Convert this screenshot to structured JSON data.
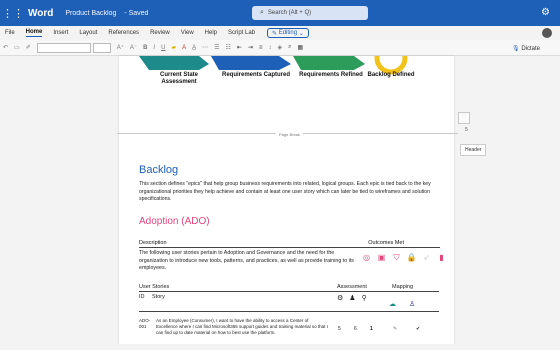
{
  "titlebar": {
    "app_name": "Word",
    "doc_title": "Product Backlog",
    "save_state": "- Saved",
    "search_placeholder": "Search (Alt + Q)"
  },
  "menu": {
    "tabs": [
      "File",
      "Home",
      "Insert",
      "Layout",
      "References",
      "Review",
      "View",
      "Help",
      "Script Lab"
    ],
    "active": "Home",
    "editing_label": "Editing"
  },
  "ribbon": {
    "dictate_label": "Dictate"
  },
  "document": {
    "stages": [
      {
        "label": "Current State Assessment"
      },
      {
        "label": "Requirements Captured"
      },
      {
        "label": "Requirements Refined"
      },
      {
        "label": "Backlog Defined"
      }
    ],
    "page_break": "Page Break",
    "backlog_heading": "Backlog",
    "backlog_intro": "This section defines \"epics\" that help group business requirements into related, logical groups. Each epic is tied back to the key organizational priorities they help achieve and contain at least one user story which can later be tied to wireframes and solution specifications.",
    "adoption_heading": "Adoption (ADO)",
    "description_label": "Description",
    "outcomes_label": "Outcomes Met",
    "description_body": "The following user stories pertain to Adoption and Governance and the need for the organization to introduce new tools, patterns, and practices, as well as provide training to its employees.",
    "user_stories_label": "User Stories",
    "assessment_label": "Assessment",
    "mapping_label": "Mapping",
    "id_label": "ID",
    "story_label": "Story",
    "rows": [
      {
        "id": "ADO-001",
        "story": "As an Employee (Consumer), I want to have the ability to access a Center of Excellence where I can find Microsoft365 support guides and training material so that I can find up to date material on how to best use the platform.",
        "n1": "5",
        "n2": "6",
        "n3": "1"
      }
    ]
  },
  "side": {
    "number": "5",
    "header_label": "Header"
  },
  "colors": {
    "brand": "#1e5fb8",
    "accent_pink": "#e0457b"
  }
}
